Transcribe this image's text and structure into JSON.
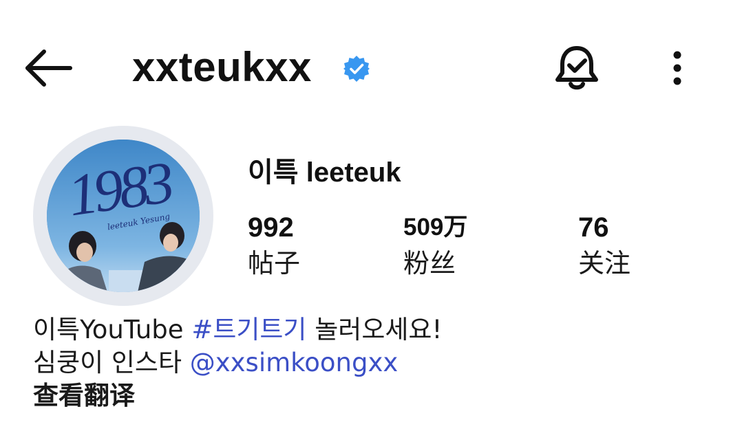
{
  "header": {
    "username": "xxteukxx",
    "verified": true,
    "icons": [
      "back-arrow-icon",
      "verified-badge-icon",
      "bell-icon",
      "more-vertical-icon"
    ],
    "accent_color": "#3897f0"
  },
  "profile": {
    "display_name": "이특 leeteuk",
    "avatar_text": {
      "year": "1983",
      "script": "leeteuk Yesung"
    }
  },
  "stats": [
    {
      "value": "992",
      "label": "帖子"
    },
    {
      "value": "509万",
      "label": "粉丝"
    },
    {
      "value": "76",
      "label": "关注"
    }
  ],
  "bio": {
    "line1_prefix": "이특YouTube ",
    "line1_hashtag": "#트기트기",
    "line1_suffix": " 놀러오세요!",
    "line2_prefix": "심쿵이 인스타 ",
    "line2_threads_symbol": "@",
    "line2_handle": "xxsimkoongxx",
    "translate_label": "查看翻译"
  },
  "colors": {
    "text": "#111111",
    "link": "#3b4fc6",
    "ring": "#e6e9ef",
    "verified": "#3897f0"
  }
}
